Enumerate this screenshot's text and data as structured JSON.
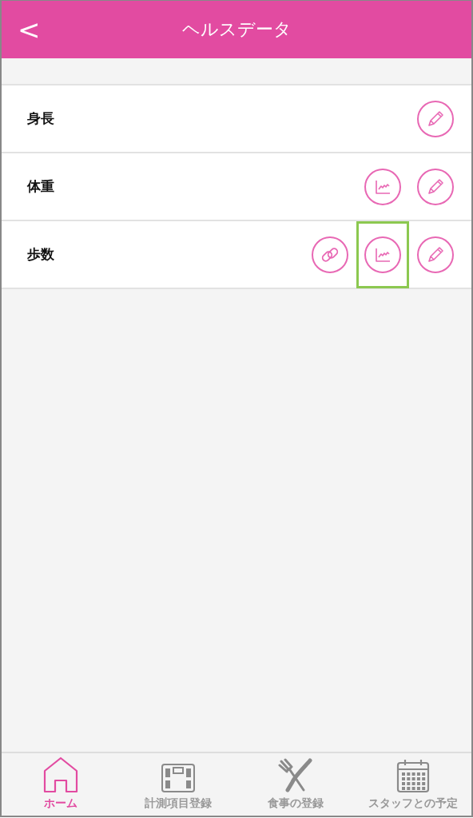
{
  "header": {
    "back": "<",
    "title": "ヘルスデータ"
  },
  "rows": [
    {
      "label": "身長",
      "actions": [
        {
          "kind": "edit",
          "highlighted": false
        }
      ]
    },
    {
      "label": "体重",
      "actions": [
        {
          "kind": "chart",
          "highlighted": false
        },
        {
          "kind": "edit",
          "highlighted": false
        }
      ]
    },
    {
      "label": "歩数",
      "actions": [
        {
          "kind": "link",
          "highlighted": false
        },
        {
          "kind": "chart",
          "highlighted": true
        },
        {
          "kind": "edit",
          "highlighted": false
        }
      ]
    }
  ],
  "tabs": [
    {
      "kind": "home",
      "label": "ホーム",
      "selected": true
    },
    {
      "kind": "scale",
      "label": "計測項目登録",
      "selected": false
    },
    {
      "kind": "meal",
      "label": "食事の登録",
      "selected": false
    },
    {
      "kind": "calendar",
      "label": "スタッフとの予定",
      "selected": false
    }
  ]
}
